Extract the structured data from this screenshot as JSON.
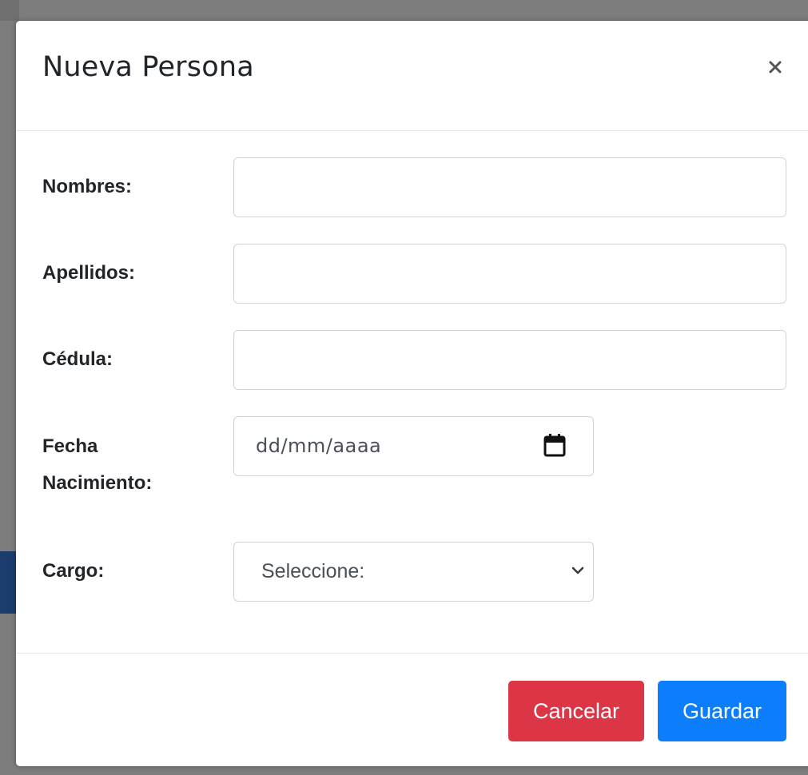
{
  "colors": {
    "backdrop": "#7d7d7d",
    "cancel_button": "#dc3545",
    "save_button": "#0d7efb",
    "input_border": "#ced4da",
    "text": "#212529"
  },
  "modal": {
    "title": "Nueva Persona",
    "close_label": "×",
    "close_icon": "close-icon"
  },
  "form": {
    "nombres": {
      "label": "Nombres:",
      "value": "",
      "placeholder": ""
    },
    "apellidos": {
      "label": "Apellidos:",
      "value": "",
      "placeholder": ""
    },
    "cedula": {
      "label": "Cédula:",
      "value": "",
      "placeholder": ""
    },
    "fecha": {
      "label_line1": "Fecha",
      "label_line2": "Nacimiento:",
      "placeholder": "dd/mm/aaaa",
      "icon": "calendar-icon"
    },
    "cargo": {
      "label": "Cargo:",
      "selected": "Seleccione:",
      "icon": "chevron-down-icon"
    }
  },
  "footer": {
    "cancel_label": "Cancelar",
    "save_label": "Guardar"
  }
}
